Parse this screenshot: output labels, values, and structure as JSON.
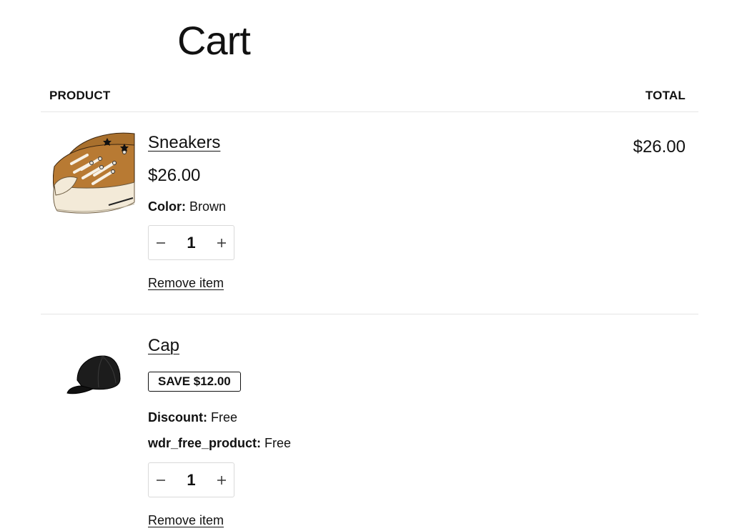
{
  "page": {
    "title": "Cart"
  },
  "table": {
    "product_header": "PRODUCT",
    "total_header": "TOTAL"
  },
  "items": [
    {
      "image_icon": "sneakers-image",
      "name": "Sneakers",
      "price": "$26.00",
      "total": "$26.00",
      "properties": [
        {
          "label": "Color:",
          "value": "Brown"
        }
      ],
      "quantity": "1",
      "remove_label": "Remove item"
    },
    {
      "image_icon": "cap-image",
      "name": "Cap",
      "badge": "SAVE $12.00",
      "properties": [
        {
          "label": "Discount:",
          "value": "Free"
        },
        {
          "label": "wdr_free_product:",
          "value": "Free"
        }
      ],
      "quantity": "1",
      "remove_label": "Remove item"
    }
  ],
  "colors": {
    "text": "#111111",
    "divider": "#e5e5e5",
    "stepper_border": "#d9d9d9",
    "sneaker_brown": "#b87a33",
    "cap_black": "#1c1c1c"
  }
}
